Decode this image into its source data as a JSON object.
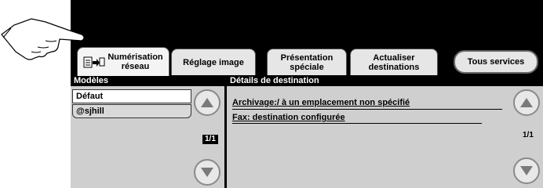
{
  "tabs": [
    {
      "line1": "Numérisation",
      "line2": "réseau"
    },
    {
      "line1": "Réglage image"
    },
    {
      "line1": "Présentation",
      "line2": "spéciale"
    },
    {
      "line1": "Actualiser",
      "line2": "destinations"
    },
    {
      "line1": "Tous services"
    }
  ],
  "left_panel": {
    "header": "Modèles",
    "items": [
      "Défaut",
      "@sjhill"
    ],
    "page": "1/1"
  },
  "right_panel": {
    "header": "Détails de destination",
    "lines": [
      "Archivage:/  à un emplacement non spécifié",
      "Fax: destination configurée"
    ],
    "page": "1/1"
  },
  "icons": [
    "pointing-hand-icon",
    "scan-to-network-icon",
    "scroll-up-icon",
    "scroll-down-icon"
  ]
}
